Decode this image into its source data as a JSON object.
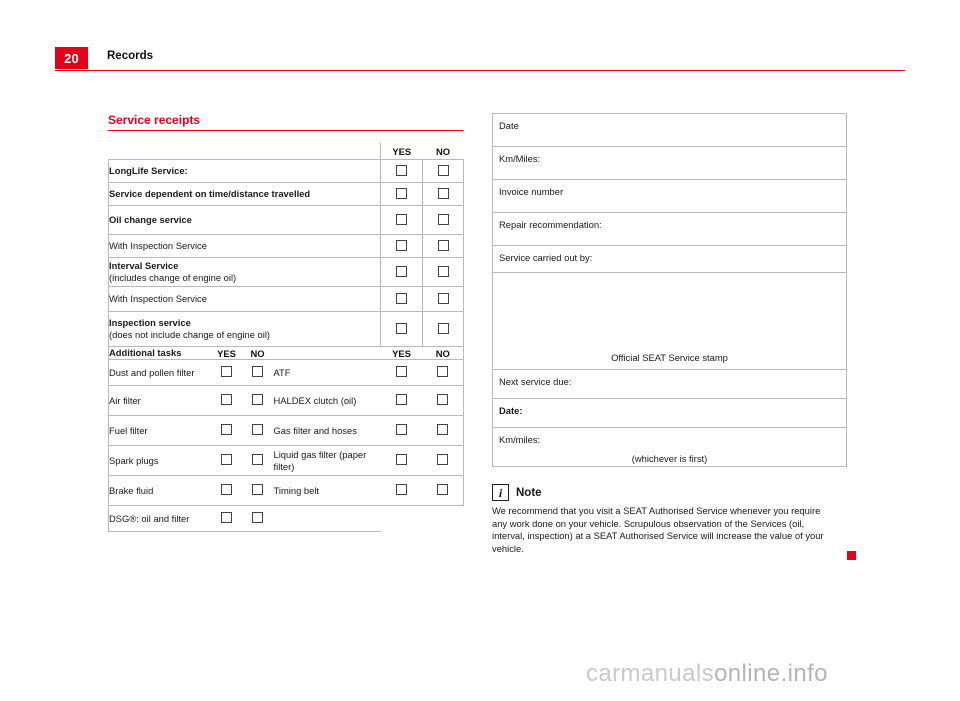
{
  "header": {
    "page_number": "20",
    "title": "Records"
  },
  "left": {
    "section_title": "Service receipts",
    "col_yes": "YES",
    "col_no": "NO",
    "rows": [
      {
        "label": "LongLife Service:",
        "bold": true
      },
      {
        "label": "Service dependent on time/distance travelled",
        "bold": true
      },
      {
        "label": "Oil change service",
        "bold": true
      },
      {
        "label": "With Inspection Service",
        "bold": false
      },
      {
        "label": "Interval Service",
        "label2": "(includes change of engine oil)",
        "bold": true
      },
      {
        "label": "With Inspection Service",
        "bold": false
      },
      {
        "label": "Inspection service",
        "label2": "(does not include change of engine oil)",
        "bold": true
      }
    ],
    "additional_header": {
      "title": "Additional tasks",
      "yes_left": "YES",
      "no_left": "NO",
      "yes_right": "YES",
      "no_right": "NO"
    },
    "additional_rows": [
      {
        "left": "Dust and pollen filter",
        "right": "ATF"
      },
      {
        "left": "Air filter",
        "right": "HALDEX clutch (oil)"
      },
      {
        "left": "Fuel filter",
        "right": "Gas filter and hoses"
      },
      {
        "left": "Spark plugs",
        "right": "Liquid gas filter (paper filter)"
      },
      {
        "left": "Brake fluid",
        "right": "Timing belt"
      },
      {
        "left": "DSG®: oil and filter",
        "right": ""
      }
    ]
  },
  "right": {
    "rows": [
      "Date",
      "Km/Miles:",
      "Invoice number",
      "Repair recommendation:",
      "Service carried out by:"
    ],
    "stamp_label": "Official SEAT Service stamp",
    "next_service_due": "Next service due:",
    "date_label": "Date:",
    "km_miles_label": "Km/miles:",
    "whichever": "(whichever is first)"
  },
  "note": {
    "icon": "info-icon",
    "glyph": "i",
    "title": "Note",
    "body": "We recommend that you visit a SEAT Authorised Service whenever you require any work done on your vehicle. Scrupulous observation of the Services (oil, interval, inspection) at a SEAT Authorised Service will increase the value of your vehicle."
  },
  "watermark": {
    "text_a": "carmanuals",
    "text_b": "online.info"
  },
  "colors": {
    "accent": "#e2001a",
    "border": "#b9b9b9",
    "text": "#1a1a1a"
  }
}
